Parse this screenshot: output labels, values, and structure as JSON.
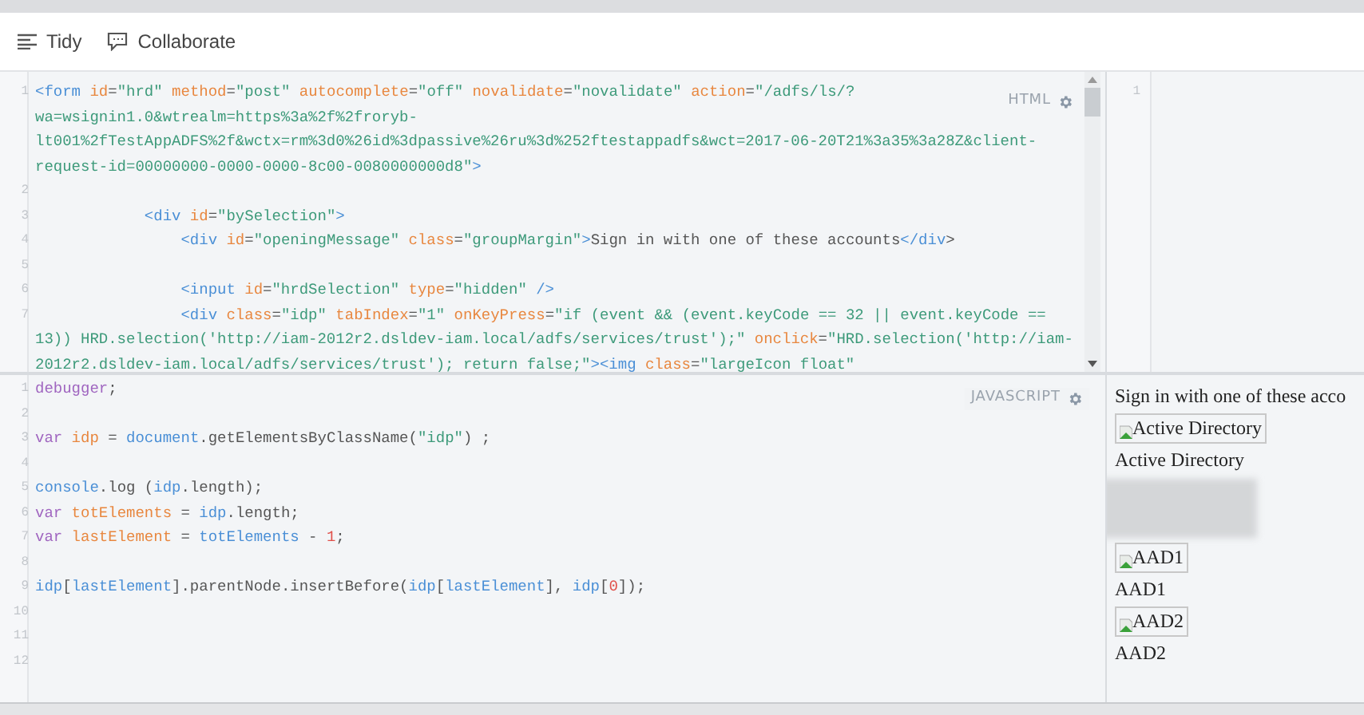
{
  "toolbar": {
    "buttons": [
      {
        "kind": "tidy",
        "label": "Tidy"
      },
      {
        "kind": "collaborate",
        "label": "Collaborate"
      }
    ]
  },
  "html_editor": {
    "label": "HTML",
    "lines": [
      {
        "number": "1",
        "wraps": [
          {
            "tokens": [
              {
                "kind": "tag",
                "text": "<form"
              },
              {
                "kind": "attr",
                "text": " id"
              },
              {
                "kind": "plain",
                "text": "="
              },
              {
                "kind": "str",
                "text": "\"hrd\""
              },
              {
                "kind": "attr",
                "text": " method"
              },
              {
                "kind": "plain",
                "text": "="
              },
              {
                "kind": "str",
                "text": "\"post\""
              },
              {
                "kind": "attr",
                "text": " autocomplete"
              },
              {
                "kind": "plain",
                "text": "="
              },
              {
                "kind": "str",
                "text": "\"off\""
              },
              {
                "kind": "attr",
                "text": " novalidate"
              },
              {
                "kind": "plain",
                "text": "="
              },
              {
                "kind": "str",
                "text": "\"novalidate\""
              },
              {
                "kind": "attr",
                "text": " action"
              },
              {
                "kind": "plain",
                "text": "="
              },
              {
                "kind": "str",
                "text": "\"/adfs/ls/?"
              }
            ]
          },
          {
            "tokens": [
              {
                "kind": "str",
                "text": "wa=wsignin1.0&wtrealm=https%3a%2f%2froryb-"
              }
            ]
          },
          {
            "tokens": [
              {
                "kind": "str",
                "text": "lt001%2fTestAppADFS%2f&wctx=rm%3d0%26id%3dpassive%26ru%3d%252ftestappadfs&wct=2017-06-20T21%3a35%3a28Z&client-"
              }
            ]
          },
          {
            "tokens": [
              {
                "kind": "str",
                "text": "request-id=00000000-0000-0000-8c00-0080000000d8\""
              },
              {
                "kind": "tag",
                "text": ">"
              }
            ]
          }
        ]
      },
      {
        "number": "2"
      },
      {
        "number": "3",
        "wraps": [
          {
            "tokens": [
              {
                "kind": "tag",
                "text": "            <div"
              },
              {
                "kind": "attr",
                "text": " id"
              },
              {
                "kind": "plain",
                "text": "="
              },
              {
                "kind": "str",
                "text": "\"bySelection\""
              },
              {
                "kind": "tag",
                "text": ">"
              }
            ]
          }
        ]
      },
      {
        "number": "4",
        "wraps": [
          {
            "tokens": [
              {
                "kind": "tag",
                "text": "                <div"
              },
              {
                "kind": "attr",
                "text": " id"
              },
              {
                "kind": "plain",
                "text": "="
              },
              {
                "kind": "str",
                "text": "\"openingMessage\""
              },
              {
                "kind": "attr",
                "text": " class"
              },
              {
                "kind": "plain",
                "text": "="
              },
              {
                "kind": "str",
                "text": "\"groupMargin\""
              },
              {
                "kind": "tag",
                "text": ">"
              },
              {
                "kind": "plain",
                "text": "Sign in with one of these accounts"
              },
              {
                "kind": "tag",
                "text": "</div"
              },
              {
                "kind": "plain",
                "text": ">"
              }
            ]
          }
        ]
      },
      {
        "number": "5"
      },
      {
        "number": "6",
        "wraps": [
          {
            "tokens": [
              {
                "kind": "tag",
                "text": "                <input"
              },
              {
                "kind": "attr",
                "text": " id"
              },
              {
                "kind": "plain",
                "text": "="
              },
              {
                "kind": "str",
                "text": "\"hrdSelection\""
              },
              {
                "kind": "attr",
                "text": " type"
              },
              {
                "kind": "plain",
                "text": "="
              },
              {
                "kind": "str",
                "text": "\"hidden\""
              },
              {
                "kind": "tag",
                "text": " />"
              }
            ]
          }
        ]
      },
      {
        "number": "7",
        "wraps": [
          {
            "tokens": [
              {
                "kind": "tag",
                "text": "                <div"
              },
              {
                "kind": "attr",
                "text": " class"
              },
              {
                "kind": "plain",
                "text": "="
              },
              {
                "kind": "str",
                "text": "\"idp\""
              },
              {
                "kind": "attr",
                "text": " tabIndex"
              },
              {
                "kind": "plain",
                "text": "="
              },
              {
                "kind": "str",
                "text": "\"1\""
              },
              {
                "kind": "attr",
                "text": " onKeyPress"
              },
              {
                "kind": "plain",
                "text": "="
              },
              {
                "kind": "str",
                "text": "\"if (event && (event.keyCode == 32 || event.keyCode =="
              }
            ]
          },
          {
            "tokens": [
              {
                "kind": "str",
                "text": "13)) HRD.selection('http://iam-2012r2.dsldev-iam.local/adfs/services/trust');\""
              },
              {
                "kind": "attr",
                "text": " onclick"
              },
              {
                "kind": "plain",
                "text": "="
              },
              {
                "kind": "str",
                "text": "\"HRD.selection('http://iam-"
              }
            ]
          },
          {
            "tokens": [
              {
                "kind": "str",
                "text": "2012r2.dsldev-iam.local/adfs/services/trust'); return false;\""
              },
              {
                "kind": "tag",
                "text": "><img"
              },
              {
                "kind": "attr",
                "text": " class"
              },
              {
                "kind": "plain",
                "text": "="
              },
              {
                "kind": "str",
                "text": "\"largeIcon float\""
              }
            ]
          }
        ]
      }
    ]
  },
  "css_editor": {
    "lines": [
      {
        "number": "1"
      }
    ]
  },
  "js_editor": {
    "label": "JAVASCRIPT",
    "lines": [
      {
        "number": "1",
        "tokens": [
          {
            "kind": "keyword",
            "text": "debugger"
          },
          {
            "kind": "plain",
            "text": ";"
          }
        ]
      },
      {
        "number": "2"
      },
      {
        "number": "3",
        "tokens": [
          {
            "kind": "keyword",
            "text": "var"
          },
          {
            "kind": "def",
            "text": " idp"
          },
          {
            "kind": "plain",
            "text": " = "
          },
          {
            "kind": "var",
            "text": "document"
          },
          {
            "kind": "plain",
            "text": ".getElementsByClassName("
          },
          {
            "kind": "str",
            "text": "\"idp\""
          },
          {
            "kind": "plain",
            "text": ") ;"
          }
        ]
      },
      {
        "number": "4"
      },
      {
        "number": "5",
        "tokens": [
          {
            "kind": "var",
            "text": "console"
          },
          {
            "kind": "plain",
            "text": ".log ("
          },
          {
            "kind": "var",
            "text": "idp"
          },
          {
            "kind": "plain",
            "text": ".length);"
          }
        ]
      },
      {
        "number": "6",
        "tokens": [
          {
            "kind": "keyword",
            "text": "var"
          },
          {
            "kind": "def",
            "text": " totElements"
          },
          {
            "kind": "plain",
            "text": " = "
          },
          {
            "kind": "var",
            "text": "idp"
          },
          {
            "kind": "plain",
            "text": ".length;"
          }
        ]
      },
      {
        "number": "7",
        "tokens": [
          {
            "kind": "keyword",
            "text": "var"
          },
          {
            "kind": "def",
            "text": " lastElement"
          },
          {
            "kind": "plain",
            "text": " = "
          },
          {
            "kind": "var",
            "text": "totElements"
          },
          {
            "kind": "plain",
            "text": " - "
          },
          {
            "kind": "num",
            "text": "1"
          },
          {
            "kind": "plain",
            "text": ";"
          }
        ]
      },
      {
        "number": "8"
      },
      {
        "number": "9",
        "tokens": [
          {
            "kind": "var",
            "text": "idp"
          },
          {
            "kind": "plain",
            "text": "["
          },
          {
            "kind": "var",
            "text": "lastElement"
          },
          {
            "kind": "plain",
            "text": "].parentNode.insertBefore("
          },
          {
            "kind": "var",
            "text": "idp"
          },
          {
            "kind": "plain",
            "text": "["
          },
          {
            "kind": "var",
            "text": "lastElement"
          },
          {
            "kind": "plain",
            "text": "], "
          },
          {
            "kind": "var",
            "text": "idp"
          },
          {
            "kind": "plain",
            "text": "["
          },
          {
            "kind": "num",
            "text": "0"
          },
          {
            "kind": "plain",
            "text": "]);"
          }
        ]
      },
      {
        "number": "10"
      },
      {
        "number": "11"
      },
      {
        "number": "12"
      }
    ]
  },
  "result": {
    "items": [
      {
        "kind": "text",
        "text": "Sign in with one of these acco"
      },
      {
        "kind": "image",
        "alt": "Active Directory"
      },
      {
        "kind": "text",
        "text": "Active Directory"
      },
      {
        "kind": "redacted"
      },
      {
        "kind": "image",
        "alt": "AAD1"
      },
      {
        "kind": "text",
        "text": "AAD1"
      },
      {
        "kind": "image",
        "alt": "AAD2"
      },
      {
        "kind": "text",
        "text": "AAD2"
      }
    ]
  }
}
